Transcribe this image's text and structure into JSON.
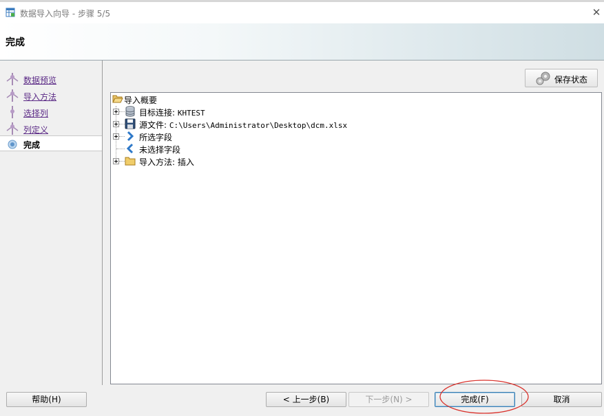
{
  "window": {
    "title": "数据导入向导 - 步骤 5/5",
    "close_icon": "close-icon"
  },
  "header": {
    "title": "完成"
  },
  "steps": [
    {
      "label": "数据预览",
      "state": "done"
    },
    {
      "label": "导入方法",
      "state": "done"
    },
    {
      "label": "选择列",
      "state": "done"
    },
    {
      "label": "列定义",
      "state": "done"
    },
    {
      "label": "完成",
      "state": "current"
    }
  ],
  "toolbar": {
    "save_state_label": "保存状态"
  },
  "summary": {
    "root_label": "导入概要",
    "items": [
      {
        "label": "目标连接: KHTEST",
        "icon": "database-icon",
        "expandable": true
      },
      {
        "label": "源文件: C:\\Users\\Administrator\\Desktop\\dcm.xlsx",
        "icon": "save-disk-icon",
        "expandable": true
      },
      {
        "label": "所选字段",
        "icon": "chevron-right-icon",
        "expandable": true
      },
      {
        "label": "未选择字段",
        "icon": "chevron-left-icon",
        "expandable": false
      },
      {
        "label": "导入方法: 插入",
        "icon": "folder-icon",
        "expandable": true
      }
    ]
  },
  "footer": {
    "help_label": "帮助(H)",
    "prev_label": "< 上一步(B)",
    "next_label": "下一步(N) >",
    "finish_label": "完成(F)",
    "cancel_label": "取消",
    "next_enabled": false
  },
  "colors": {
    "visited_link": "#5b2a86",
    "annotation_circle": "#d9302a",
    "header_gradient_end": "#cfdee3"
  }
}
